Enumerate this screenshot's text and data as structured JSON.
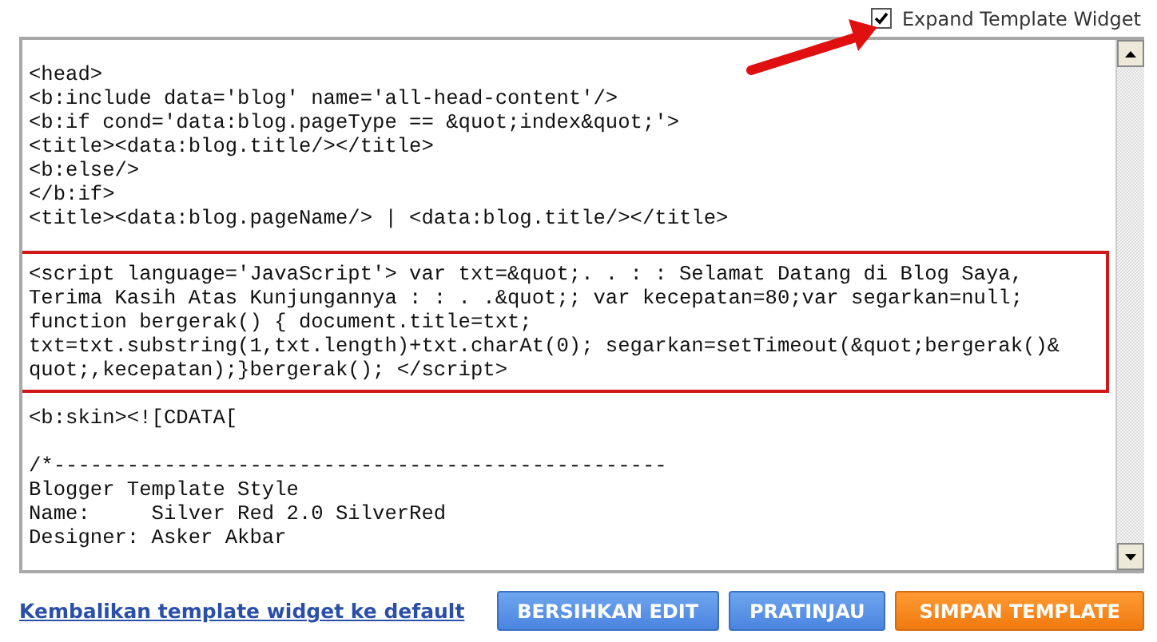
{
  "expand_widget": {
    "label": "Expand Template Widget",
    "checked": true
  },
  "editor": {
    "blocks": [
      {
        "highlighted": false,
        "lines": [
          "<head>",
          "<b:include data='blog' name='all-head-content'/>",
          "<b:if cond='data:blog.pageType == &quot;index&quot;'>",
          "<title><data:blog.title/></title>",
          "<b:else/>",
          "</b:if>",
          "<title><data:blog.pageName/> | <data:blog.title/></title>"
        ]
      },
      {
        "highlighted": true,
        "lines": [
          "<script language='JavaScript'> var txt=&quot;. . : : Selamat Datang di Blog Saya,",
          "Terima Kasih Atas Kunjungannya : : . .&quot;; var kecepatan=80;var segarkan=null;",
          "function bergerak() { document.title=txt;",
          "txt=txt.substring(1,txt.length)+txt.charAt(0); segarkan=setTimeout(&quot;bergerak()&",
          "quot;,kecepatan);}bergerak(); </script>"
        ]
      },
      {
        "highlighted": false,
        "lines": [
          "<b:skin><![CDATA["
        ]
      },
      {
        "highlighted": false,
        "lines": [
          "/*--------------------------------------------------",
          "Blogger Template Style",
          "Name:     Silver Red 2.0 SilverRed",
          "Designer: Asker Akbar"
        ]
      }
    ]
  },
  "reset_link": "Kembalikan template widget ke default",
  "buttons": [
    {
      "label": "BERSIHKAN EDIT",
      "kind": "secondary"
    },
    {
      "label": "PRATINJAU",
      "kind": "secondary"
    },
    {
      "label": "SIMPAN TEMPLATE",
      "kind": "primary"
    }
  ]
}
